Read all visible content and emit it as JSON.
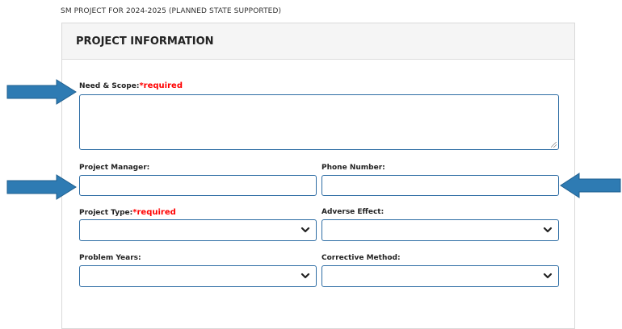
{
  "breadcrumb": "SM PROJECT FOR 2024-2025 (PLANNED STATE SUPPORTED)",
  "panel": {
    "title": "PROJECT INFORMATION"
  },
  "form": {
    "need_scope": {
      "label": "Need & Scope:",
      "required": "*required",
      "value": ""
    },
    "project_manager": {
      "label": "Project Manager:",
      "value": ""
    },
    "phone_number": {
      "label": "Phone Number:",
      "value": ""
    },
    "project_type": {
      "label": "Project Type:",
      "required": "*required",
      "value": ""
    },
    "adverse_effect": {
      "label": "Adverse Effect:",
      "value": ""
    },
    "problem_years": {
      "label": "Problem Years:",
      "value": ""
    },
    "corrective_method": {
      "label": "Corrective Method:",
      "value": ""
    }
  },
  "colors": {
    "field_border": "#2e6da4",
    "required_text": "#ff0000",
    "annotation_arrow": "#2e7bb3"
  },
  "icons": {
    "select_chevron": "chevron-down-icon",
    "annotation": "arrow-icon"
  }
}
